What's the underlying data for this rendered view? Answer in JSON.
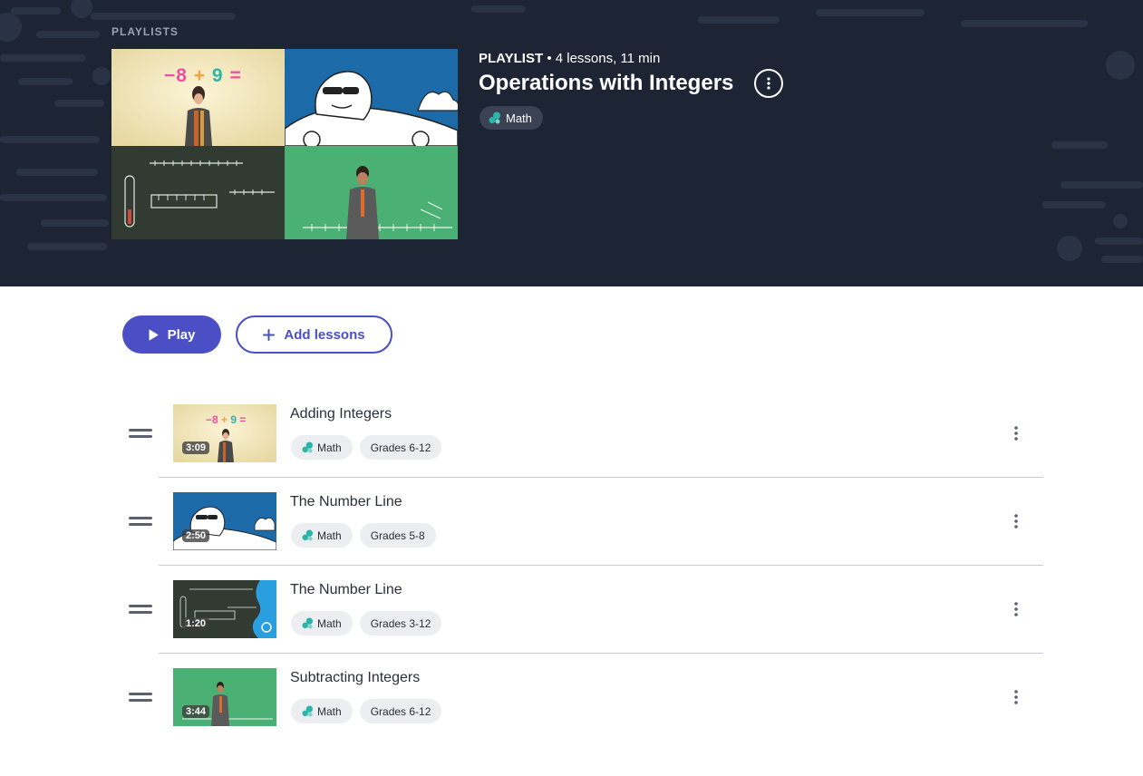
{
  "header": {
    "breadcrumb": "PLAYLISTS",
    "playlist_label": "PLAYLIST",
    "meta_text": "4 lessons, 11 min",
    "title": "Operations with Integers",
    "subject": "Math"
  },
  "thumb_texts": {
    "equation_a": "−8",
    "equation_plus": "+",
    "equation_b": "9",
    "equation_eq": "="
  },
  "actions": {
    "play_label": "Play",
    "add_label": "Add lessons"
  },
  "lessons": [
    {
      "title": "Adding Integers",
      "duration": "3:09",
      "subject": "Math",
      "grades": "Grades 6-12"
    },
    {
      "title": "The Number Line",
      "duration": "2:50",
      "subject": "Math",
      "grades": "Grades 5-8"
    },
    {
      "title": "The Number Line",
      "duration": "1:20",
      "subject": "Math",
      "grades": "Grades 3-12"
    },
    {
      "title": "Subtracting Integers",
      "duration": "3:44",
      "subject": "Math",
      "grades": "Grades 6-12"
    }
  ],
  "colors": {
    "header_bg": "#1d2433",
    "accent": "#4a4fc5",
    "subject_icon": "#2bb5a8",
    "tag_bg": "#eceef2"
  },
  "icons": [
    "play-icon",
    "plus-icon",
    "kebab-icon",
    "drag-handle-icon",
    "math-subject-icon"
  ]
}
